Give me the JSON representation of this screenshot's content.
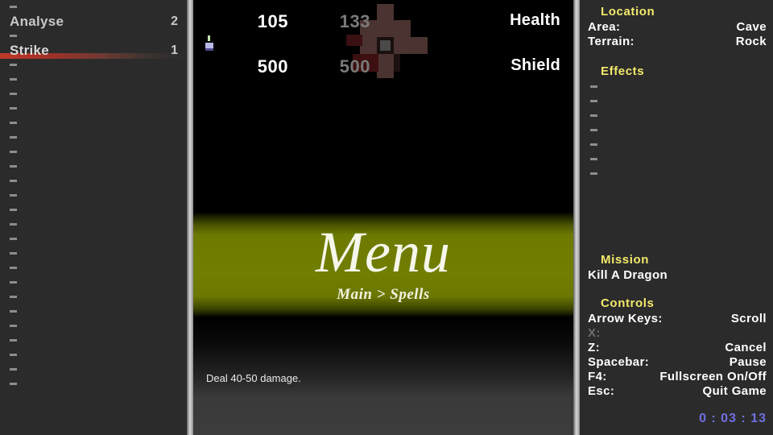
{
  "spells_panel": {
    "rows": [
      {
        "type": "dash"
      },
      {
        "type": "spell",
        "name": "Analyse",
        "cost": "2",
        "selected": false
      },
      {
        "type": "dash"
      },
      {
        "type": "spell",
        "name": "Strike",
        "cost": "1",
        "selected": true
      },
      {
        "type": "dash"
      },
      {
        "type": "dash"
      },
      {
        "type": "dash"
      },
      {
        "type": "dash"
      },
      {
        "type": "dash"
      },
      {
        "type": "dash"
      },
      {
        "type": "dash"
      },
      {
        "type": "dash"
      },
      {
        "type": "dash"
      },
      {
        "type": "dash"
      },
      {
        "type": "dash"
      },
      {
        "type": "dash"
      },
      {
        "type": "dash"
      },
      {
        "type": "dash"
      },
      {
        "type": "dash"
      },
      {
        "type": "dash"
      },
      {
        "type": "dash"
      },
      {
        "type": "dash"
      },
      {
        "type": "dash"
      },
      {
        "type": "dash"
      },
      {
        "type": "dash"
      },
      {
        "type": "dash"
      },
      {
        "type": "dash"
      }
    ]
  },
  "battle": {
    "stats": [
      {
        "label": "Health",
        "current": "105",
        "max": "133"
      },
      {
        "label": "Shield",
        "current": "500",
        "max": "500"
      }
    ],
    "enemy_sprite_name": "dragon-sprite",
    "player_sprite_name": "player-sprite"
  },
  "menu": {
    "title": "Menu",
    "breadcrumb": "Main > Spells",
    "description": "Deal 40-50 damage."
  },
  "info": {
    "location": {
      "heading": "Location",
      "rows": [
        {
          "key": "Area:",
          "value": "Cave",
          "dim": false
        },
        {
          "key": "Terrain:",
          "value": "Rock",
          "dim": false
        }
      ]
    },
    "effects": {
      "heading": "Effects",
      "slots": [
        "-",
        "-",
        "-",
        "-",
        "-",
        "-",
        "-"
      ]
    },
    "mission": {
      "heading": "Mission",
      "text": "Kill A Dragon"
    },
    "controls": {
      "heading": "Controls",
      "rows": [
        {
          "key": "Arrow Keys:",
          "value": "Scroll",
          "dim": false
        },
        {
          "key": "X:",
          "value": "",
          "dim": true
        },
        {
          "key": "Z:",
          "value": "Cancel",
          "dim": false
        },
        {
          "key": "Spacebar:",
          "value": "Pause",
          "dim": false
        },
        {
          "key": "F4:",
          "value": "Fullscreen On/Off",
          "dim": false
        },
        {
          "key": "Esc:",
          "value": "Quit Game",
          "dim": false
        }
      ]
    },
    "timer": "0 : 03 : 13"
  },
  "colors": {
    "panel_bg": "#2b2b2b",
    "menu_green": "#717e00",
    "heading_yellow": "#f2e96b",
    "timer_blue": "#6f6fe2",
    "highlight_red": "#c0392b"
  }
}
